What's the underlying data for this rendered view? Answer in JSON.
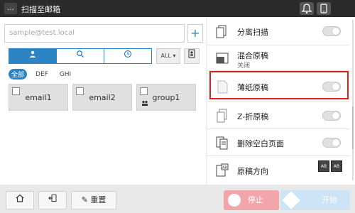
{
  "topbar": {
    "title": "扫描至邮箱",
    "menu_icon": "…"
  },
  "left": {
    "address_placeholder": "sample@test.local",
    "add_label": "+",
    "tabs": [
      {
        "name": "person",
        "label": "👤"
      },
      {
        "name": "search",
        "label": "🔍"
      },
      {
        "name": "history",
        "label": "◷"
      }
    ],
    "sort_label": "ALL",
    "index_items": [
      "全部",
      "DEF",
      "GHI"
    ],
    "tiles": [
      {
        "name": "email1"
      },
      {
        "name": "email2"
      },
      {
        "name": "group1"
      }
    ]
  },
  "right": {
    "rows": [
      {
        "label": "分离扫描",
        "icon": "separate-scan-icon"
      },
      {
        "label": "混合原稿",
        "sub": "关闭",
        "icon": "mixed-original-icon"
      },
      {
        "label": "薄纸原稿",
        "icon": "thin-paper-icon"
      },
      {
        "label": "Z-折原稿",
        "icon": "z-fold-icon"
      },
      {
        "label": "删除空白页面",
        "icon": "blank-page-delete-icon"
      },
      {
        "label": "原稿方向",
        "icon": "original-direction-icon"
      }
    ]
  },
  "bottom": {
    "home_icon": "⌂",
    "exit_icon": "⇦",
    "reset_label": "重置",
    "stop_label": "停止",
    "start_label": "开始"
  },
  "colors": {
    "accent": "#2d84c5",
    "highlight": "#e01e1e",
    "stop": "#f2a6ab",
    "start": "#cde3f6"
  }
}
